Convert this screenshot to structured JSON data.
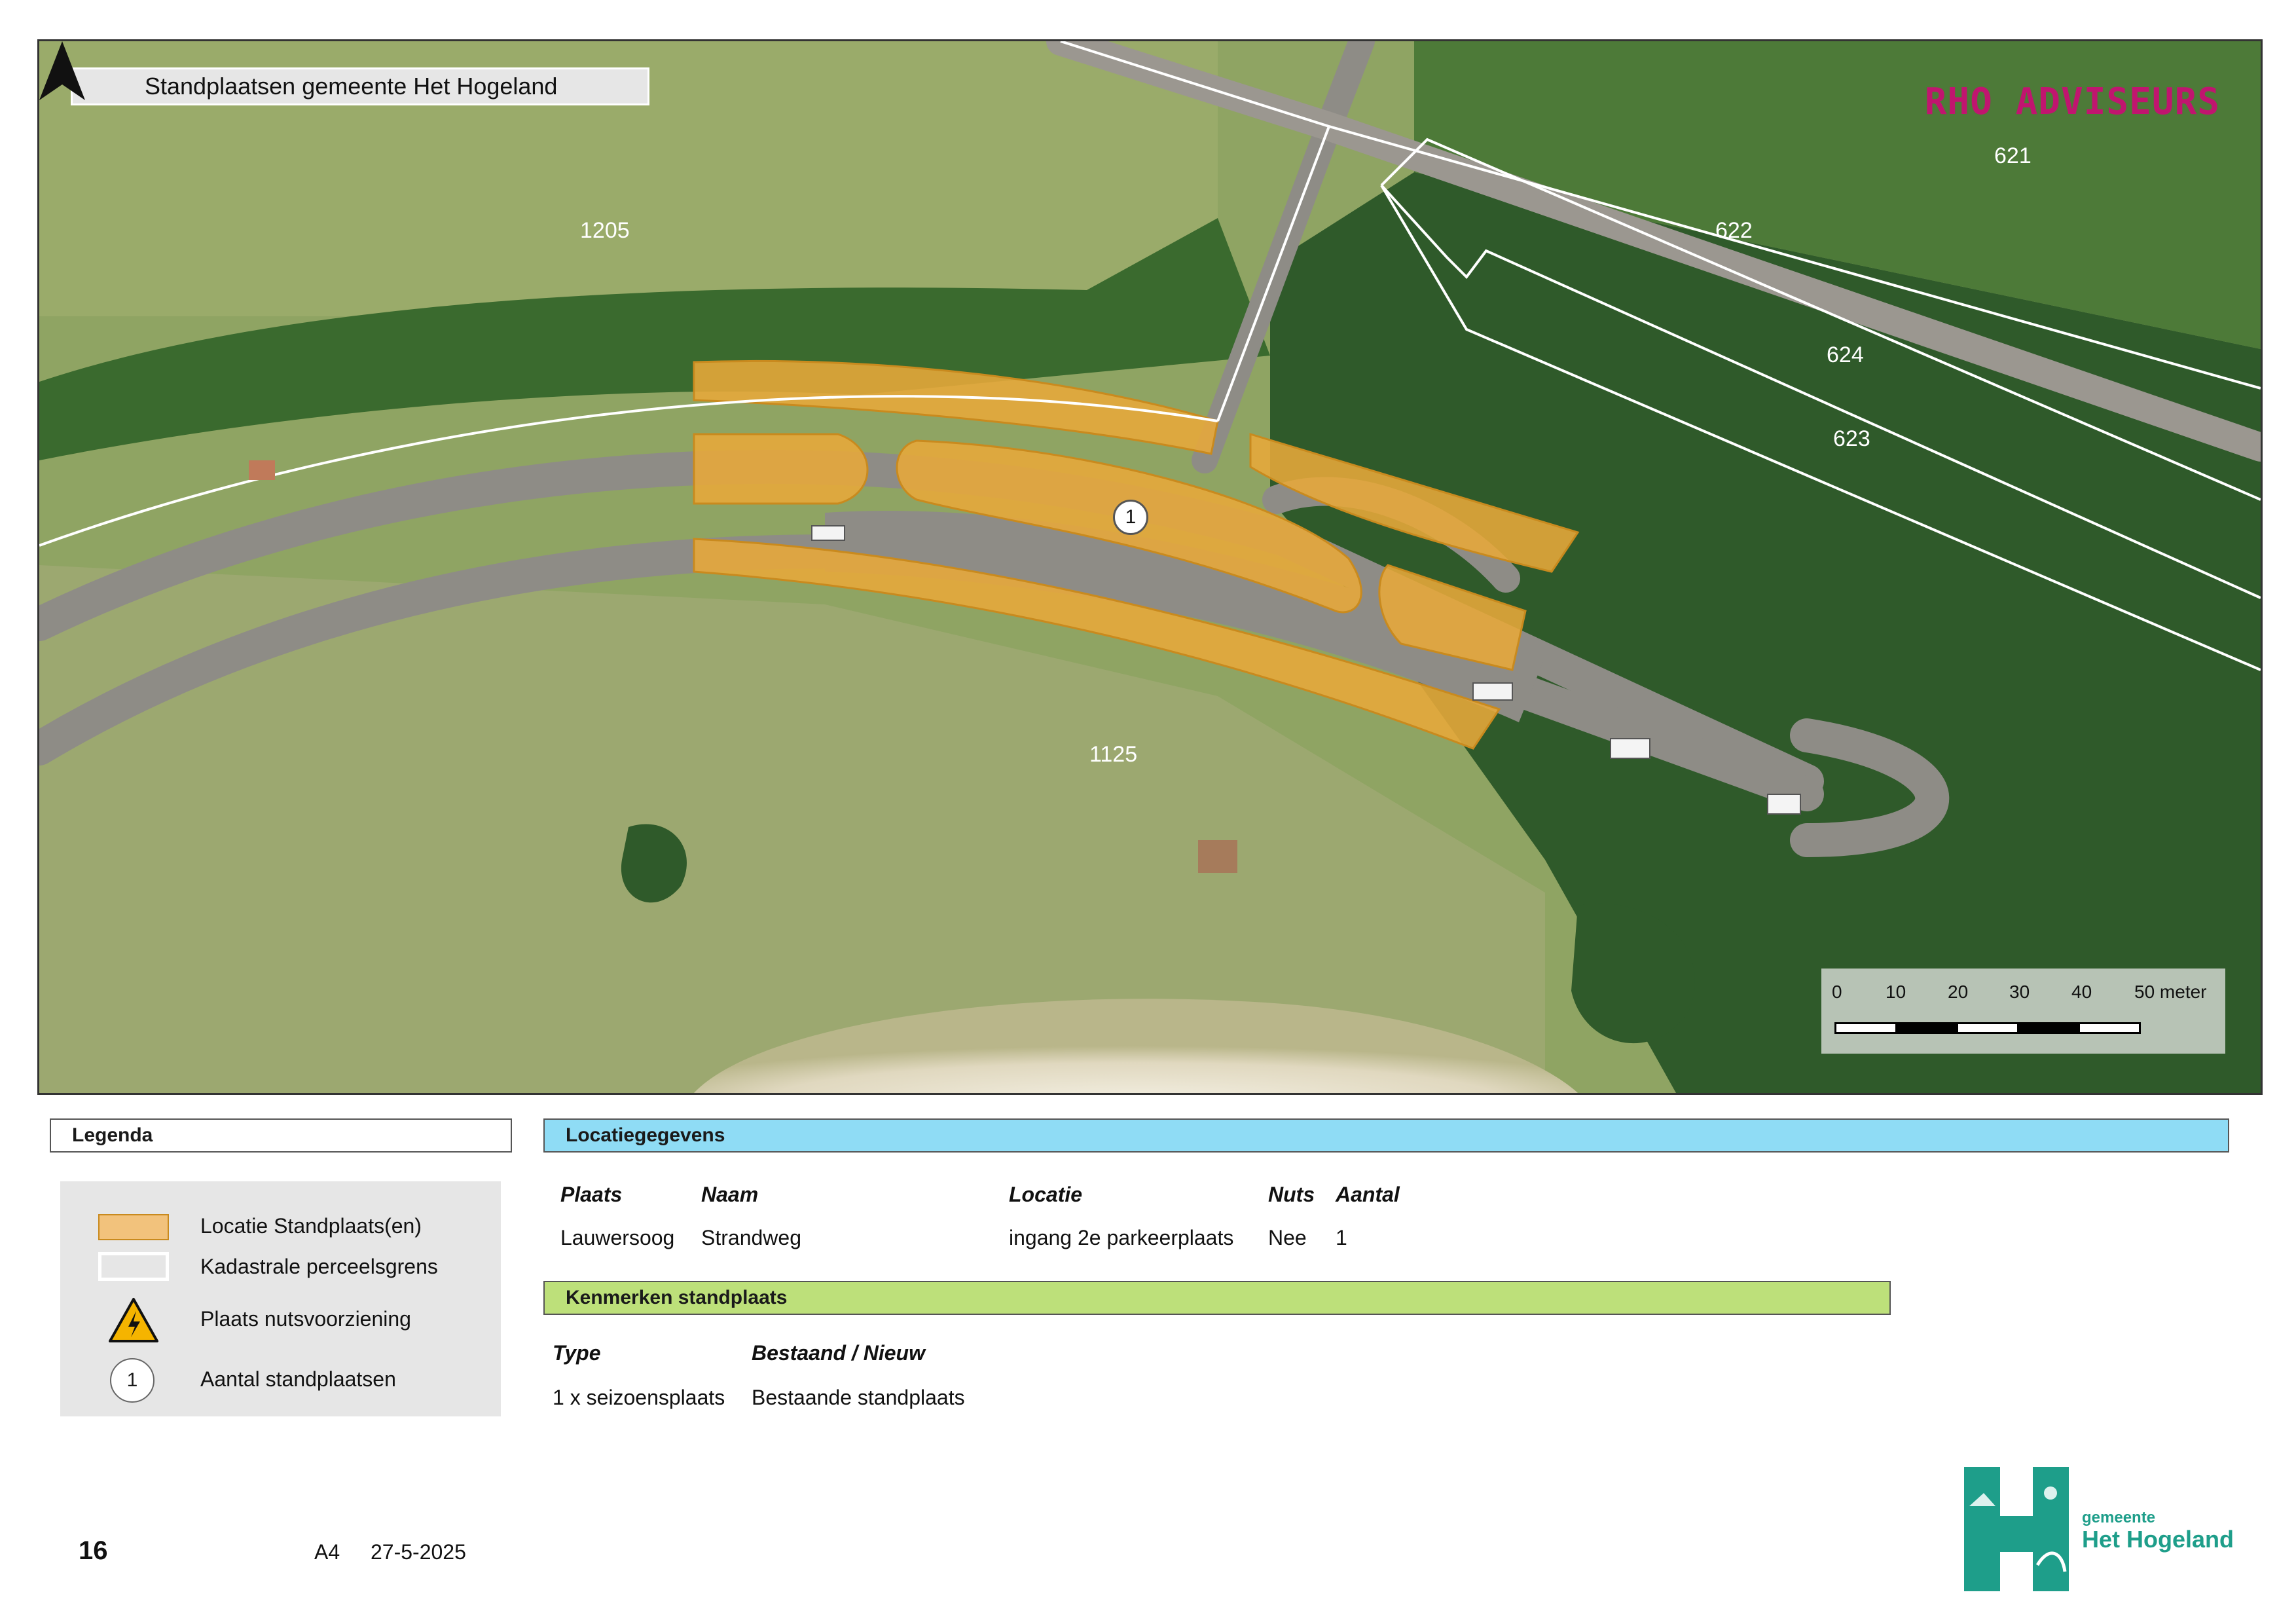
{
  "map": {
    "title": "Standplaatsen gemeente Het Hogeland",
    "brand": "RHO ADVISEURS",
    "parcels": [
      "1205",
      "621",
      "622",
      "624",
      "623",
      "1125"
    ],
    "marker_count": "1",
    "scale": {
      "ticks": [
        "0",
        "10",
        "20",
        "30",
        "40",
        "50 meter"
      ]
    },
    "colors": {
      "standplaats": "#e8a93a",
      "parcel_boundary": "#ffffff",
      "road": "#8e8c86",
      "grass": "#8fa463",
      "forest": "#2f5a2a"
    },
    "north_arrow_icon": "north-arrow-icon"
  },
  "legend": {
    "title": "Legenda",
    "items": [
      {
        "icon": "orange-area-swatch",
        "label": "Locatie Standplaats(en)"
      },
      {
        "icon": "parcel-boundary-swatch",
        "label": "Kadastrale perceelsgrens"
      },
      {
        "icon": "high-voltage-warning-icon",
        "label": "Plaats nutsvoorziening"
      },
      {
        "icon": "numbered-circle-icon",
        "label": "Aantal standplaatsen",
        "symbol": "1"
      }
    ]
  },
  "location": {
    "title": "Locatiegegevens",
    "headers": [
      "Plaats",
      "Naam",
      "Locatie",
      "Nuts",
      "Aantal"
    ],
    "row": [
      "Lauwersoog",
      "Strandweg",
      "ingang 2e parkeerplaats",
      "Nee",
      "1"
    ]
  },
  "features": {
    "title": "Kenmerken standplaats",
    "headers": [
      "Type",
      "Bestaand / Nieuw"
    ],
    "row": [
      "1 x seizoensplaats",
      "Bestaande standplaats"
    ]
  },
  "footer": {
    "page_number": "16",
    "paper": "A4",
    "date": "27-5-2025",
    "logo_small": "gemeente",
    "logo_large": "Het Hogeland"
  }
}
